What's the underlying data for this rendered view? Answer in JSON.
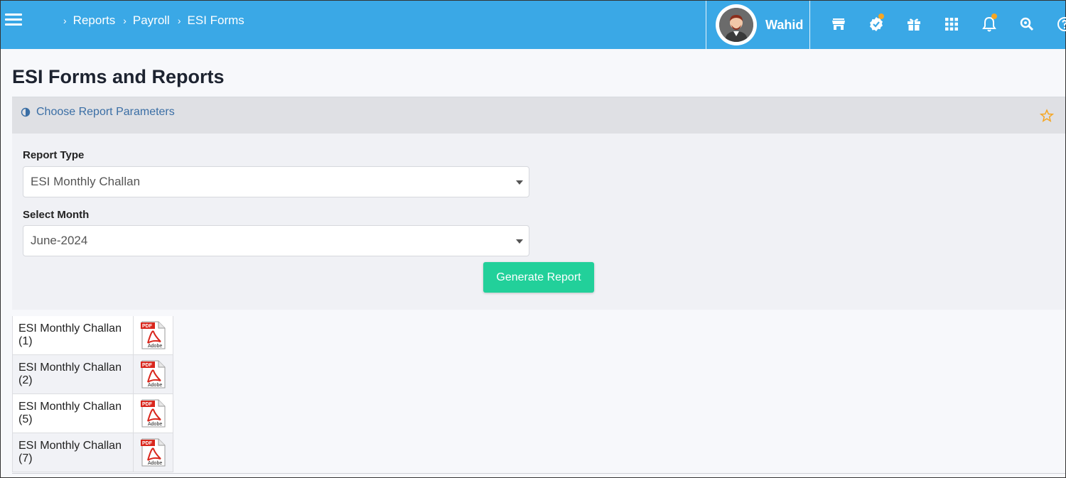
{
  "header": {
    "breadcrumb": [
      "Reports",
      "Payroll",
      "ESI Forms"
    ],
    "user_name": "Wahid",
    "icons": [
      "store-icon",
      "verified-badge-icon",
      "gift-icon",
      "apps-grid-icon",
      "bell-icon",
      "search-icon",
      "help-icon"
    ]
  },
  "page": {
    "title": "ESI Forms and Reports"
  },
  "panel": {
    "title": "Choose Report Parameters",
    "report_type_label": "Report Type",
    "report_type_value": "ESI Monthly Challan",
    "month_label": "Select Month",
    "month_value": "June-2024",
    "generate_label": "Generate Report"
  },
  "files": [
    {
      "name": "ESI Monthly Challan (1)"
    },
    {
      "name": "ESI Monthly Challan (2)"
    },
    {
      "name": "ESI Monthly Challan (5)"
    },
    {
      "name": "ESI Monthly Challan (7)"
    }
  ],
  "colors": {
    "topbar": "#3aa8e6",
    "accent_button": "#22d09a",
    "star": "#f5a623",
    "link": "#3a6ea5"
  }
}
